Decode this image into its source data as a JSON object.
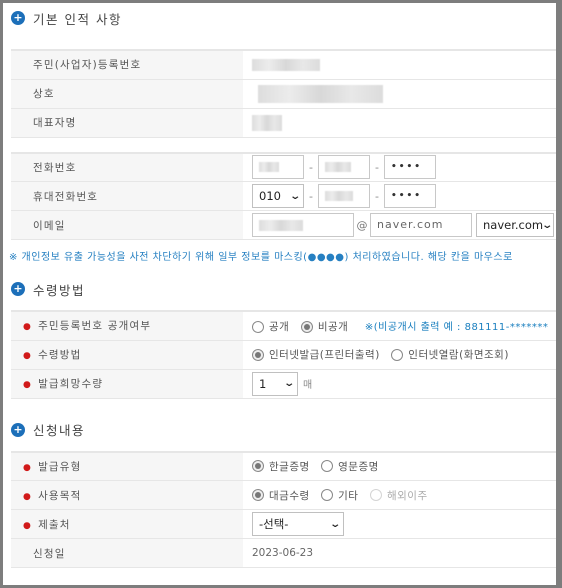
{
  "section1": {
    "title": "기본 인적 사항",
    "rows": [
      {
        "label": "주민(사업자)등록번호"
      },
      {
        "label": "상호"
      },
      {
        "label": "대표자명"
      }
    ]
  },
  "contact": {
    "phone_label": "전화번호",
    "phone_part3": "••••",
    "mobile_label": "휴대전화번호",
    "mobile_prefix": "010",
    "mobile_part3": "••••",
    "email_label": "이메일",
    "email_at": "@",
    "email_domain_value": "naver.com",
    "email_domain_select": "naver.com"
  },
  "notice": "※ 개인정보 유출 가능성을 사전 차단하기 위해 일부 정보를 마스킹(●●●●) 처리하였습니다. 해당 칸을 마우스로",
  "section2": {
    "title": "수령방법",
    "rrn_disclosure_label": "주민등록번호 공개여부",
    "rrn_options": [
      {
        "label": "공개",
        "checked": false
      },
      {
        "label": "비공개",
        "checked": true
      }
    ],
    "rrn_note": "※(비공개시 출력 예 : 881111-*******",
    "receive_label": "수령방법",
    "receive_options": [
      {
        "label": "인터넷발급(프린터출력)",
        "checked": true
      },
      {
        "label": "인터넷열람(화면조회)",
        "checked": false
      }
    ],
    "copies_label": "발급희망수량",
    "copies_value": "1",
    "copies_unit": "매"
  },
  "section3": {
    "title": "신청내용",
    "type_label": "발급유형",
    "type_options": [
      {
        "label": "한글증명",
        "checked": true
      },
      {
        "label": "영문증명",
        "checked": false
      }
    ],
    "purpose_label": "사용목적",
    "purpose_options": [
      {
        "label": "대금수령",
        "checked": true
      },
      {
        "label": "기타",
        "checked": false
      },
      {
        "label": "해외이주",
        "checked": false,
        "disabled": true
      }
    ],
    "submit_to_label": "제출처",
    "submit_to_value": "-선택-",
    "apply_date_label": "신청일",
    "apply_date_value": "2023-06-23"
  }
}
